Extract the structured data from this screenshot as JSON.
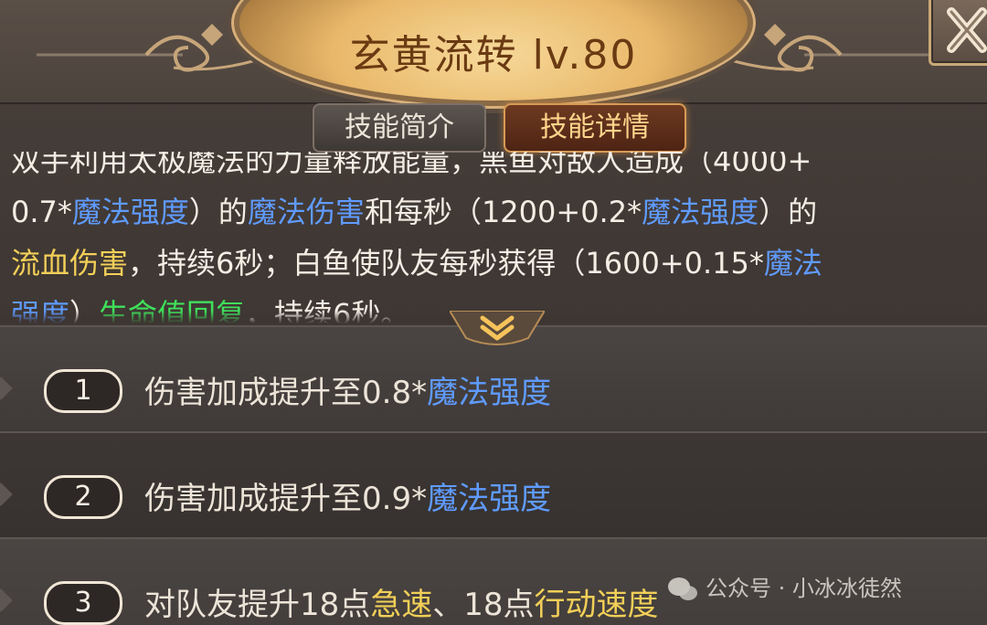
{
  "header": {
    "title": "玄黄流转 lv.80"
  },
  "tabs": [
    {
      "label": "技能简介",
      "active": false
    },
    {
      "label": "技能详情",
      "active": true
    }
  ],
  "description": {
    "line1": "双手利用太极魔法的力量释放能量，黑鱼对敌人造成（4000+",
    "line2a": "0.7*",
    "line2b": "魔法强度",
    "line2c": "）的",
    "line2d": "魔法伤害",
    "line2e": "和每秒（1200+0.2*",
    "line2f": "魔法强度",
    "line2g": "）的",
    "line3a": "流血伤害",
    "line3b": "，持续6秒；白鱼使队友每秒获得（1600+0.15*",
    "line3c": "魔法",
    "line4a": "强度",
    "line4b": "）",
    "line4c": "生命值回复",
    "line4d": "，持续6秒。"
  },
  "upgrades": [
    {
      "number": "1",
      "prefix": "伤害加成提升至0.8*",
      "keyword": "魔法强度",
      "keyword_color": "blue"
    },
    {
      "number": "2",
      "prefix": "伤害加成提升至0.9*",
      "keyword": "魔法强度",
      "keyword_color": "blue"
    },
    {
      "number": "3",
      "prefix": "对队友提升18点",
      "keyword": "急速",
      "middle": "、18点",
      "keyword2": "行动速度",
      "keyword_color": "gold"
    }
  ],
  "watermark": "公众号 · 小冰冰徒然",
  "icons": {
    "close": "close-icon",
    "expand": "chevron-double-down-icon",
    "wechat": "wechat-icon"
  },
  "colors": {
    "magic_keyword": "#5f9bff",
    "effect_keyword": "#f2cf58",
    "heal_keyword": "#3fe05a",
    "active_tab_text": "#ffd58c"
  }
}
